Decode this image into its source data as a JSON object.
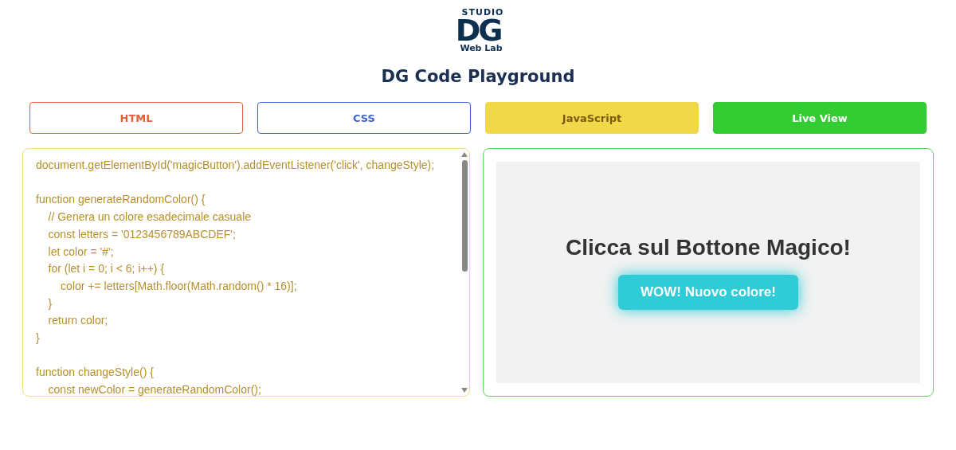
{
  "logo": {
    "top": "STUDIO",
    "mark": "DG",
    "bottom": "Web Lab"
  },
  "title": "DG Code Playground",
  "tabs": [
    {
      "label": "HTML",
      "color": "#e0603a",
      "selected": false
    },
    {
      "label": "CSS",
      "color": "#3a62d0",
      "selected": false
    },
    {
      "label": "JavaScript",
      "color": "#f0d84a",
      "selected": true
    },
    {
      "label": "Live View",
      "color": "#33cc33",
      "selected": true
    }
  ],
  "editor": {
    "lines": [
      {
        "text": "document.getElementById('magicButton').addEventListener('click', changeStyle);",
        "blank_before": false
      },
      {
        "text": "function generateRandomColor() {",
        "blank_before": true
      },
      {
        "text": "    // Genera un colore esadecimale casuale",
        "blank_before": false
      },
      {
        "text": "    const letters = '0123456789ABCDEF';",
        "blank_before": false
      },
      {
        "text": "    let color = '#';",
        "blank_before": false
      },
      {
        "text": "    for (let i = 0; i < 6; i++) {",
        "blank_before": false
      },
      {
        "text": "        color += letters[Math.floor(Math.random() * 16)];",
        "blank_before": false
      },
      {
        "text": "    }",
        "blank_before": false
      },
      {
        "text": "    return color;",
        "blank_before": false
      },
      {
        "text": "}",
        "blank_before": false
      },
      {
        "text": "function changeStyle() {",
        "blank_before": true
      },
      {
        "text": "    const newColor = generateRandomColor();",
        "blank_before": false
      }
    ]
  },
  "preview": {
    "heading": "Clicca sul Bottone Magico!",
    "button": "WOW! Nuovo colore!"
  }
}
